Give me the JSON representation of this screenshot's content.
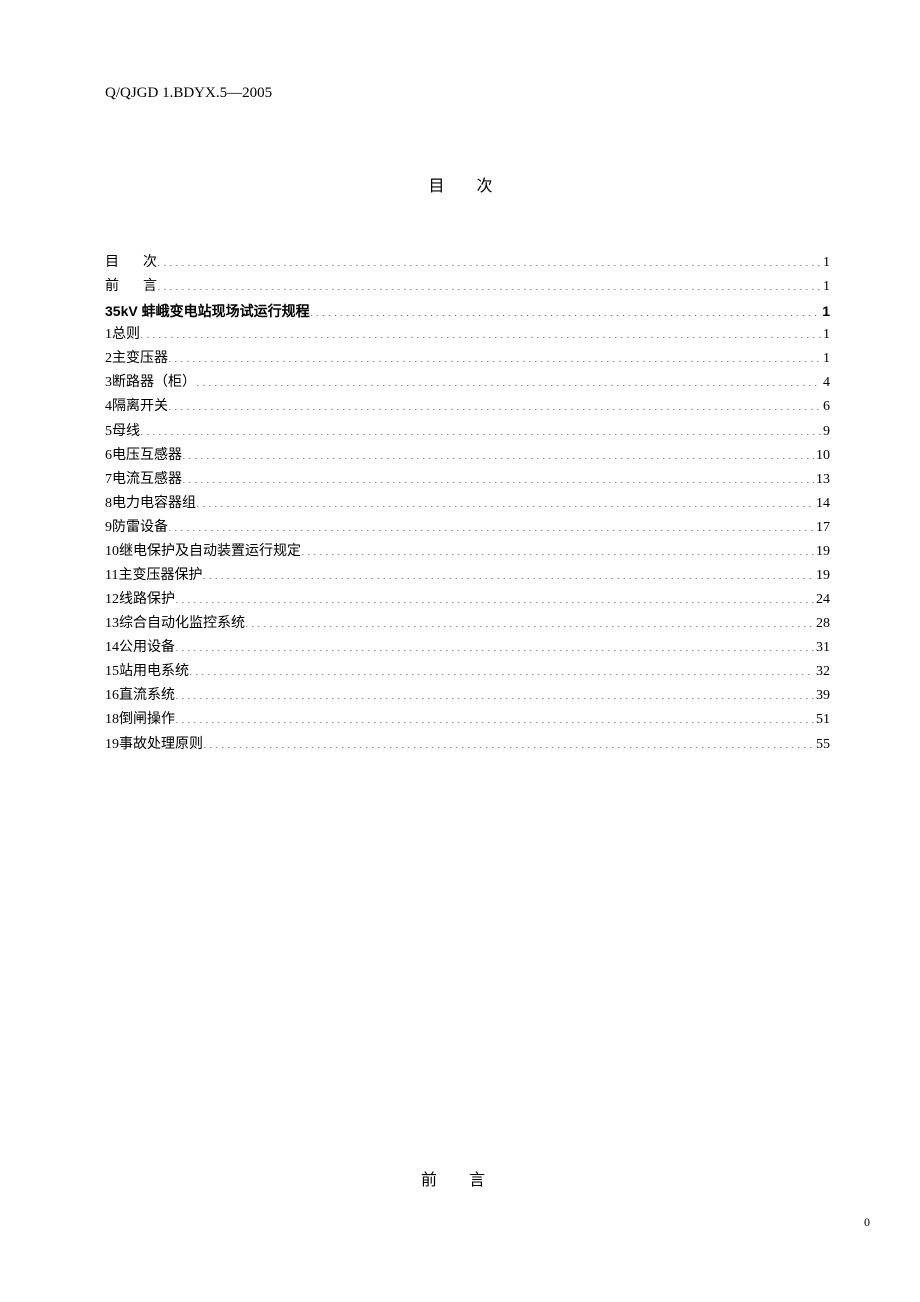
{
  "header_code": "Q/QJGD 1.BDYX.5—2005",
  "title": "目    次",
  "toc": [
    {
      "prefix": "目",
      "spacer": "    ",
      "text": "次",
      "page": "1",
      "spaced": true,
      "bold": false
    },
    {
      "prefix": "前",
      "spacer": "    ",
      "text": "言",
      "page": "1",
      "spaced": true,
      "bold": false
    },
    {
      "prefix": "",
      "spacer": "",
      "text": "35kV 蚌峨变电站现场试运行规程",
      "page": "1",
      "spaced": false,
      "bold": true
    },
    {
      "prefix": "1",
      "spacer": " ",
      "text": "总则",
      "page": "1",
      "spaced": false,
      "bold": false
    },
    {
      "prefix": "2",
      "spacer": " ",
      "text": "主变压器",
      "page": "1",
      "spaced": false,
      "bold": false
    },
    {
      "prefix": "3",
      "spacer": " ",
      "text": "断路器（柜）",
      "page": "4",
      "spaced": false,
      "bold": false
    },
    {
      "prefix": "4",
      "spacer": " ",
      "text": "隔离开关",
      "page": "6",
      "spaced": false,
      "bold": false
    },
    {
      "prefix": "5",
      "spacer": " ",
      "text": "母线",
      "page": "9",
      "spaced": false,
      "bold": false
    },
    {
      "prefix": "6",
      "spacer": " ",
      "text": "电压互感器",
      "page": "10",
      "spaced": false,
      "bold": false
    },
    {
      "prefix": "7",
      "spacer": " ",
      "text": "电流互感器",
      "page": "13",
      "spaced": false,
      "bold": false
    },
    {
      "prefix": "8",
      "spacer": " ",
      "text": "电力电容器组",
      "page": "14",
      "spaced": false,
      "bold": false
    },
    {
      "prefix": "9",
      "spacer": " ",
      "text": "防雷设备",
      "page": "17",
      "spaced": false,
      "bold": false
    },
    {
      "prefix": "10",
      "spacer": " ",
      "text": "继电保护及自动装置运行规定",
      "page": "19",
      "spaced": false,
      "bold": false
    },
    {
      "prefix": "11",
      "spacer": " ",
      "text": "主变压器保护",
      "page": "19",
      "spaced": false,
      "bold": false
    },
    {
      "prefix": "12",
      "spacer": " ",
      "text": "线路保护",
      "page": "24",
      "spaced": false,
      "bold": false
    },
    {
      "prefix": "13",
      "spacer": " ",
      "text": "综合自动化监控系统",
      "page": "28",
      "spaced": false,
      "bold": false
    },
    {
      "prefix": "14",
      "spacer": " ",
      "text": "公用设备",
      "page": "31",
      "spaced": false,
      "bold": false
    },
    {
      "prefix": "15",
      "spacer": " ",
      "text": "站用电系统",
      "page": "32",
      "spaced": false,
      "bold": false
    },
    {
      "prefix": "16",
      "spacer": " ",
      "text": "直流系统",
      "page": "39",
      "spaced": false,
      "bold": false
    },
    {
      "prefix": "18",
      "spacer": " ",
      "text": "倒闸操作",
      "page": "51",
      "spaced": false,
      "bold": false
    },
    {
      "prefix": "19",
      "spacer": " ",
      "text": "事故处理原则",
      "page": "55",
      "spaced": false,
      "bold": false
    }
  ],
  "preface_title": "前    言",
  "page_number": "0"
}
